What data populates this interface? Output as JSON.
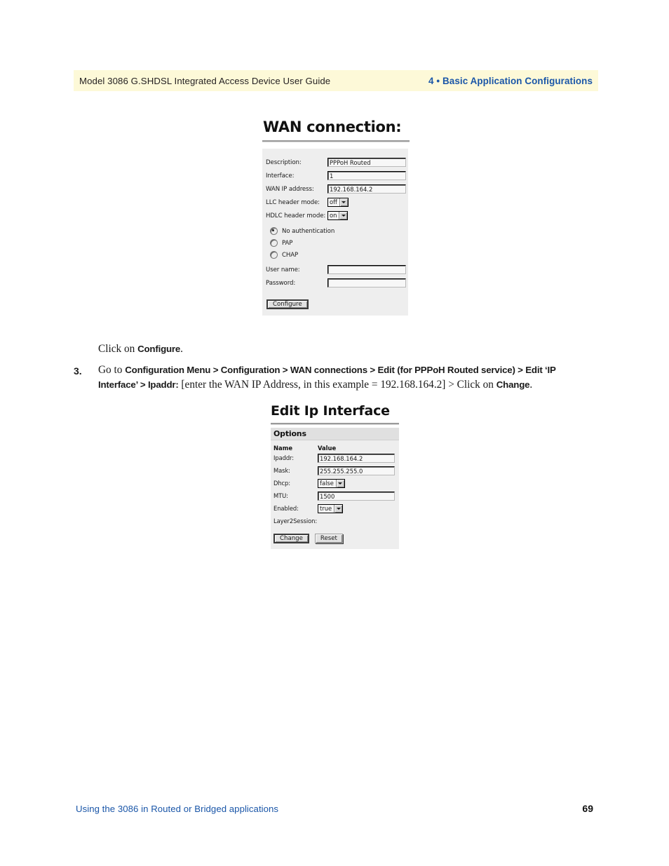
{
  "header": {
    "left": "Model 3086 G.SHDSL Integrated Access Device User Guide",
    "right": "4 • Basic Application Configurations",
    "bg_color": "#fdf9d8",
    "accent_color": "#1a56a8"
  },
  "figures": {
    "wan_connection": {
      "title": "WAN connection:",
      "fields": [
        {
          "label": "Description:",
          "type": "text",
          "value": "PPPoH Routed"
        },
        {
          "label": "Interface:",
          "type": "text",
          "value": "1"
        },
        {
          "label": "WAN IP address:",
          "type": "text",
          "value": "192.168.164.2"
        },
        {
          "label": "LLC header mode:",
          "type": "select",
          "value": "off"
        },
        {
          "label": "HDLC header mode:",
          "type": "select",
          "value": "on"
        }
      ],
      "auth_options": [
        {
          "label": "No authentication",
          "selected": true
        },
        {
          "label": "PAP",
          "selected": false
        },
        {
          "label": "CHAP",
          "selected": false
        }
      ],
      "credential_fields": [
        {
          "label": "User name:",
          "type": "text",
          "value": ""
        },
        {
          "label": "Password:",
          "type": "text",
          "value": ""
        }
      ],
      "button": "Configure"
    },
    "edit_ip_interface": {
      "title": "Edit Ip Interface",
      "section_header": "Options",
      "columns": [
        "Name",
        "Value"
      ],
      "rows": [
        {
          "name": "Ipaddr:",
          "type": "text",
          "value": "192.168.164.2"
        },
        {
          "name": "Mask:",
          "type": "text",
          "value": "255.255.255.0"
        },
        {
          "name": "Dhcp:",
          "type": "select",
          "value": "false"
        },
        {
          "name": "MTU:",
          "type": "text",
          "value": "1500"
        },
        {
          "name": "Enabled:",
          "type": "select",
          "value": "true"
        },
        {
          "name": "Layer2Session:",
          "type": "none",
          "value": ""
        }
      ],
      "buttons": [
        "Change",
        "Reset"
      ]
    }
  },
  "body": {
    "click_configure": {
      "lead": "Click on ",
      "bold": "Configure",
      "tail": "."
    },
    "step3": {
      "number": "3.",
      "p1": "Go to ",
      "b1": "Configuration Menu > Configuration > WAN connections > Edit (for PPPoH Routed service) > Edit ‘IP Interface’ > Ipaddr:",
      "p2": " [enter the WAN IP Address, in this example = 192.168.164.2] > Click on ",
      "b2": "Change",
      "p3": "."
    }
  },
  "footer": {
    "left": "Using the 3086 in Routed or Bridged applications",
    "page_number": "69"
  }
}
